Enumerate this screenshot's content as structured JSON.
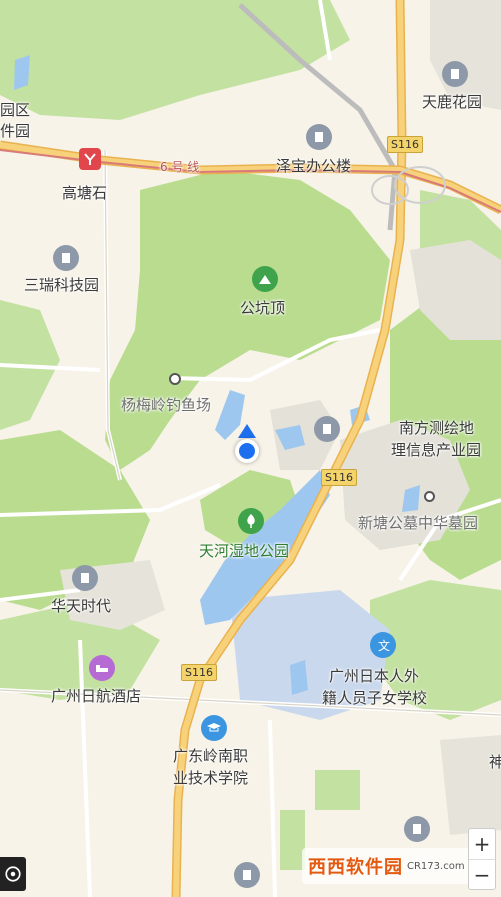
{
  "labels": {
    "park_zone": "园区",
    "software_park": "件园",
    "tianlu_garden": "天鹿花园",
    "gaotangshi": "高塘石",
    "metro_line": "6 号 线",
    "zebao_office": "泽宝办公楼",
    "sanrui_tech": "三瑞科技园",
    "gongkengding": "公坑顶",
    "yangmeiling_fishpond": "杨梅岭钓鱼场",
    "nanfang_survey": "南方测绘地理信息产业园",
    "nanfang_survey_line1": "南方测绘地",
    "nanfang_survey_line2": "理信息产业园",
    "xintang_cemetery": "新塘公墓中华墓园",
    "tianhe_wetland": "天河湿地公园",
    "huatian_times": "华天时代",
    "japanese_school_line1": "广州日本人外",
    "japanese_school_line2": "籍人员子女学校",
    "rihang_hotel": "广州日航酒店",
    "lingnan_line1": "广东岭南职",
    "lingnan_line2": "业技术学院",
    "edge_char": "神"
  },
  "road_shields": {
    "s116_top": "S116",
    "s116_mid": "S116",
    "s116_bottom": "S116"
  },
  "controls": {
    "zoom_in": "+",
    "zoom_out": "−"
  },
  "watermark": {
    "main": "西西软件园",
    "sub": "CR173.com"
  },
  "colors": {
    "land": "#f7f3e8",
    "green": "#b9dc8f",
    "water": "#9ec7ef",
    "metro": "#e08a8a",
    "highway": "#f5c76a",
    "location": "#1e6ff0"
  }
}
